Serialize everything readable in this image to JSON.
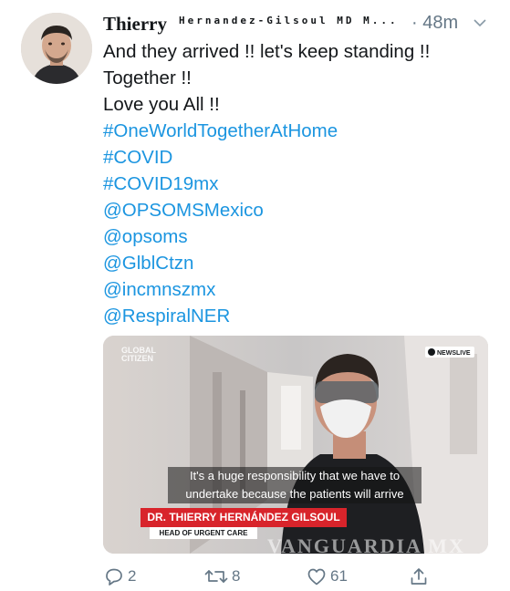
{
  "tweet": {
    "author_name": "Thierry",
    "author_handle": "Hernandez-Gilsoul MD M...",
    "time": "· 48m",
    "lines": [
      "And they arrived !!  let's keep standing !!",
      "Together !!",
      "Love you All !!"
    ],
    "tags": [
      "#OneWorldTogetherAtHome",
      "#COVID",
      "#COVID19mx",
      "@OPSOMSMexico",
      "@opsoms",
      "@GlblCtzn",
      "@incmnszmx",
      "@RespiralNER"
    ]
  },
  "media": {
    "logo": "GLOBAL CITIZEN",
    "network": "NEWSLIVE",
    "network_mark": "abc",
    "caption_line1": "It's a huge responsibility that we have to",
    "caption_line2": "undertake because the patients will arrive",
    "lower_third_name": "DR. THIERRY HERNÁNDEZ GILSOUL",
    "lower_third_title": "HEAD OF URGENT CARE",
    "watermark": "VANGUARDIA MX"
  },
  "actions": {
    "replies": "2",
    "retweets": "8",
    "likes": "61"
  },
  "colors": {
    "link": "#1b95e0",
    "muted": "#657786",
    "lower_third": "#d8242b"
  },
  "icons": [
    "chevron-down-icon",
    "reply-icon",
    "retweet-icon",
    "like-icon",
    "share-icon"
  ]
}
